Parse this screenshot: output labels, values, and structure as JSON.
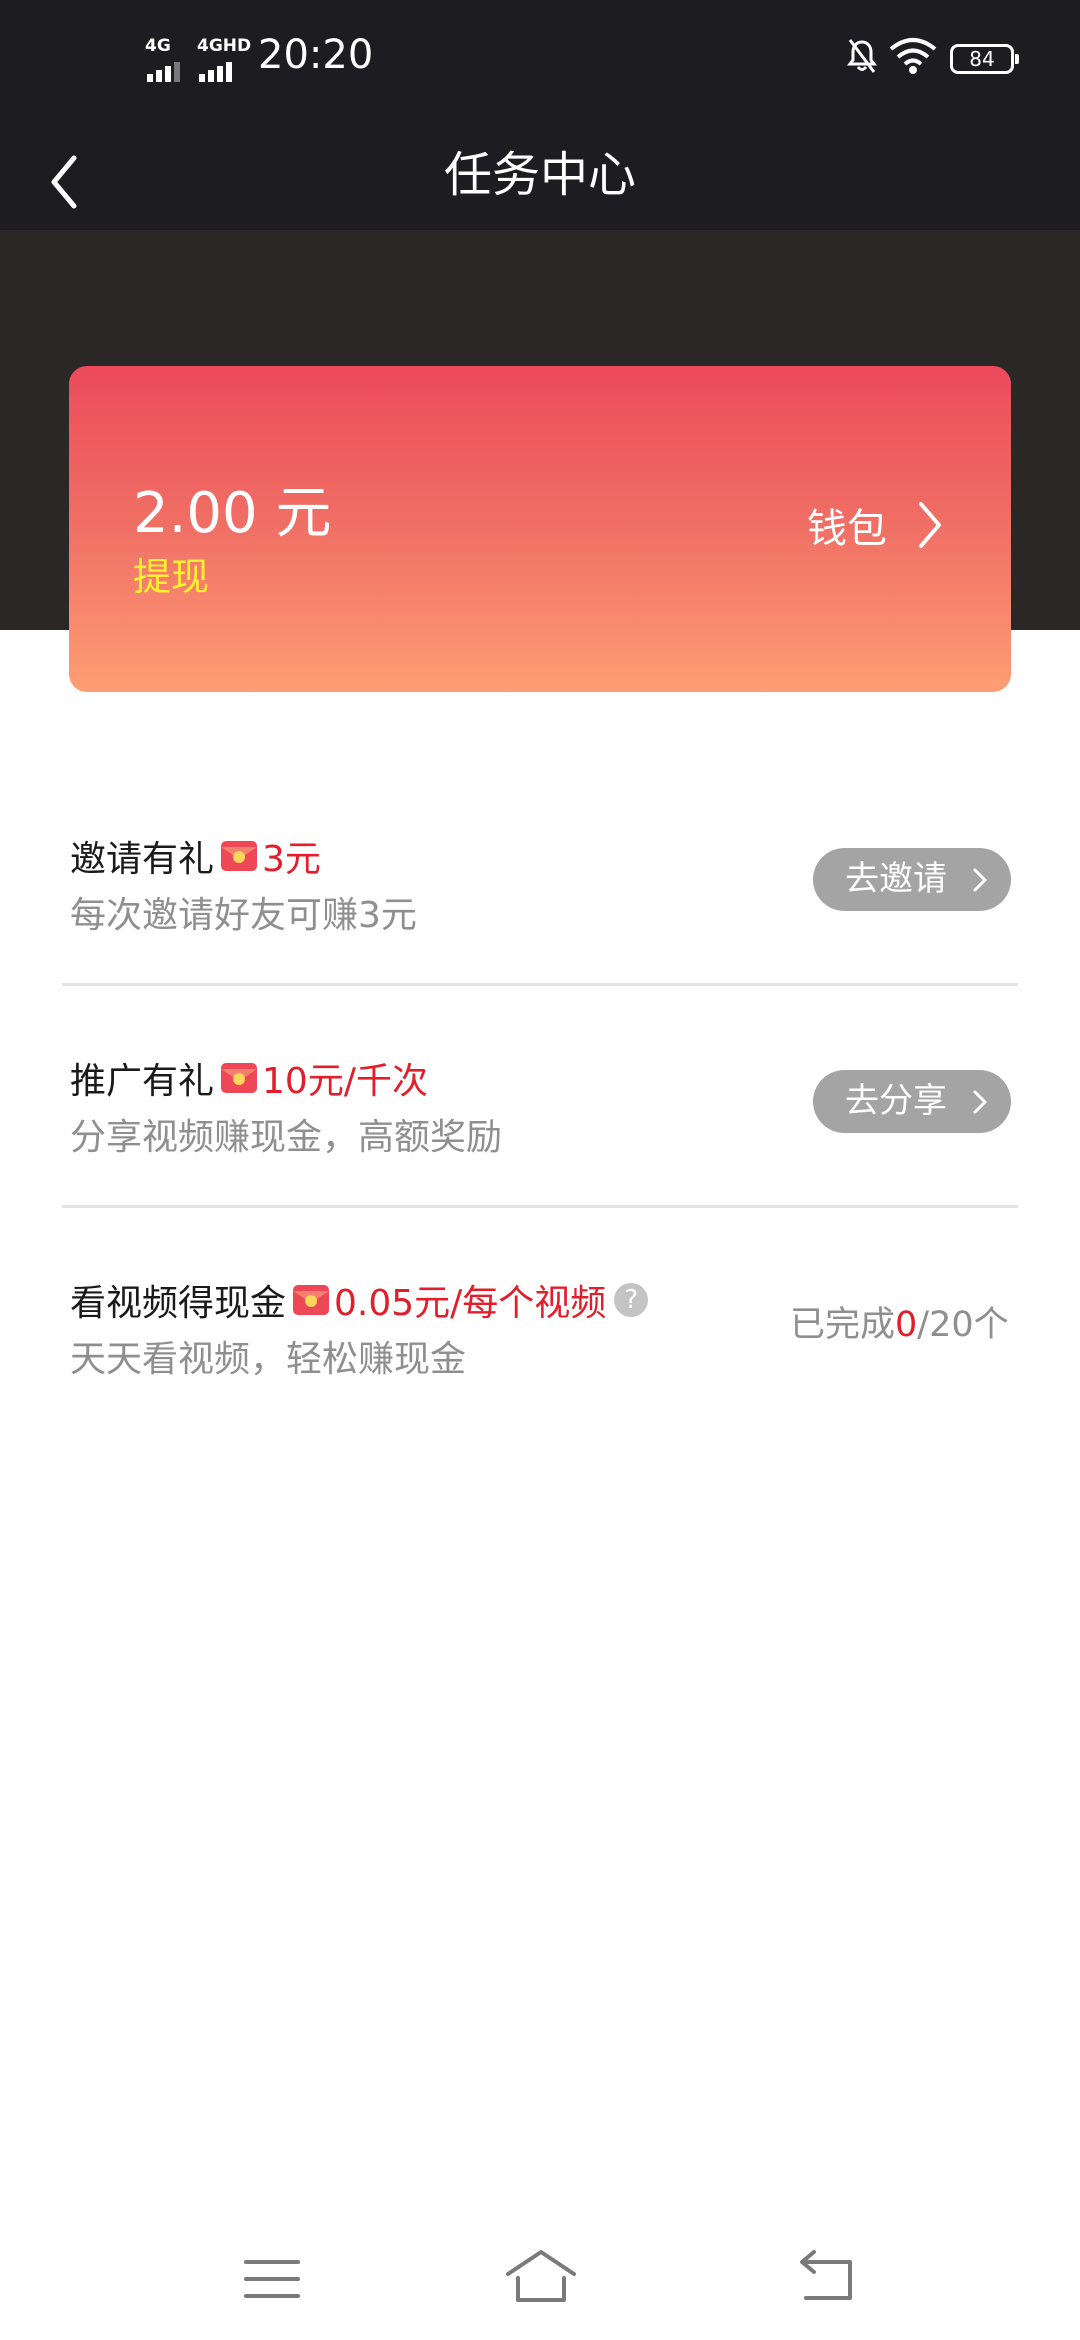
{
  "status_bar": {
    "network_1": "4G",
    "network_2": "4GHD",
    "time": "20:20",
    "battery": "84"
  },
  "header": {
    "title": "任务中心"
  },
  "wallet_card": {
    "amount": "2.00 元",
    "withdraw_label": "提现",
    "wallet_label": "钱包"
  },
  "tasks": [
    {
      "title": "邀请有礼",
      "reward": "3元",
      "description": "每次邀请好友可赚3元",
      "button_label": "去邀请"
    },
    {
      "title": "推广有礼",
      "reward": "10元/千次",
      "description": "分享视频赚现金，高额奖励",
      "button_label": "去分享"
    },
    {
      "title": "看视频得现金",
      "reward": "0.05元/每个视频",
      "help_symbol": "?",
      "description": "天天看视频，轻松赚现金",
      "progress_prefix": "已完成",
      "progress_done": "0",
      "progress_total": "/20个"
    }
  ],
  "colors": {
    "header_bg": "#1d1c21",
    "hero_bg": "#2b2726",
    "card_gradient_top": "#ec4a5b",
    "card_gradient_bottom": "#fe9e74",
    "reward_red": "#e41d2a",
    "withdraw_yellow": "#fff12e",
    "button_gray": "#a4a4a4"
  },
  "icons": {
    "back": "back-arrow-icon",
    "wallet_chevron": "chevron-right-icon",
    "reward": "red-envelope-icon",
    "help": "question-circle-icon",
    "sys_menu": "menu-icon",
    "sys_home": "home-icon",
    "sys_back": "back-icon"
  }
}
